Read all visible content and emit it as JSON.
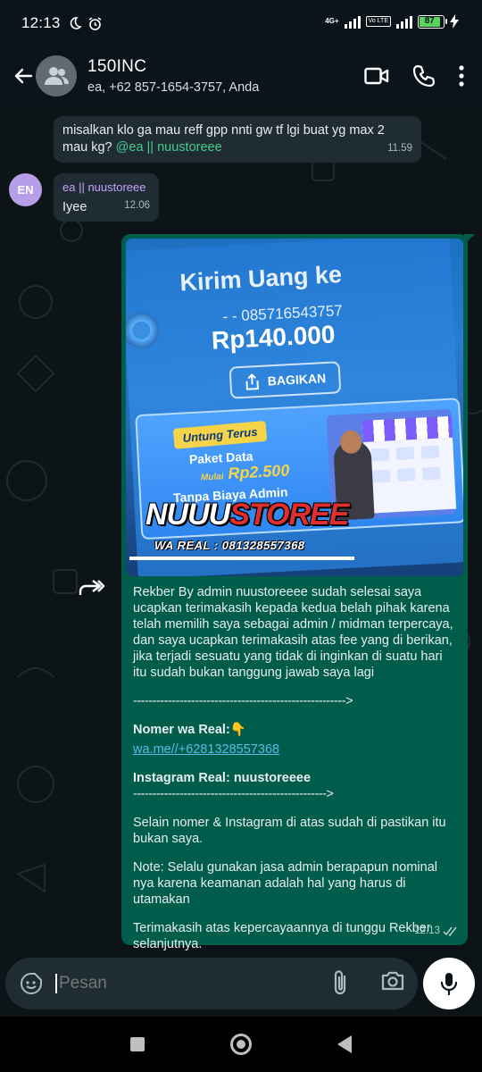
{
  "status_bar": {
    "time": "12:13",
    "network": "4G+",
    "volte": "Vo LTE",
    "battery": "87"
  },
  "header": {
    "title": "150INC",
    "subtitle": "ea, +62 857-1654-3757, Anda"
  },
  "messages": [
    {
      "type": "incoming",
      "text": "misalkan klo ga mau reff gpp nnti gw tf lgi buat yg max 2 mau kg? ",
      "mention": "@ea || nuustoreee",
      "time": "11.59"
    },
    {
      "type": "incoming",
      "avatar": "EN",
      "sender": "ea || nuustoreee",
      "text": "Iyee",
      "time": "12.06"
    },
    {
      "type": "outgoing",
      "forwarded": true,
      "image": {
        "kirim": "Kirim Uang ke",
        "rek": "- - 085716543757",
        "nominal": "Rp140.000",
        "bagikan": "BAGIKAN",
        "untung": "Untung Terus",
        "paket": "Paket Data",
        "mulai_prefix": "Mulai",
        "mulai_price": "Rp2.500",
        "tanpa": "Tanpa Biaya Admin",
        "brand_a": "NUUU",
        "brand_b": "STOREE",
        "wareal": "WA REAL : 081328557368"
      },
      "caption": {
        "para1": "Rekber By admin nuustoreeee sudah selesai saya ucapkan terimakasih kepada kedua belah pihak karena telah memilih saya sebagai admin / midman terpercaya, dan saya ucapkan terimakasih atas fee yang di berikan, jika terjadi sesuatu yang tidak di inginkan di suatu hari itu sudah bukan tanggung jawab saya lagi",
        "divider1": "------------------------------------------------------->",
        "nomer_label": "Nomer wa Real:👇",
        "link": "wa.me//+6281328557368",
        "ig_label": "Instagram Real: nuustoreeee",
        "divider2": "-------------------------------------------------->",
        "para2": "Selain nomer & Instagram di atas sudah di pastikan itu bukan saya.",
        "para3": "Note: Selalu gunakan jasa admin berapapun nominal nya karena keamanan adalah hal yang harus di utamakan",
        "para4": "Terimakasih atas kepercayaannya di tunggu Rekber selanjutnya."
      },
      "time": "12.13"
    }
  ],
  "input": {
    "placeholder": "Pesan"
  },
  "icons": {
    "back": "arrow-left-icon",
    "video": "video-call-icon",
    "call": "phone-icon",
    "menu": "more-vertical-icon",
    "sticker": "sticker-icon",
    "attach": "paperclip-icon",
    "camera": "camera-icon",
    "mic": "microphone-icon",
    "forward": "forward-icon"
  },
  "colors": {
    "outgoing_bubble": "#005c4b",
    "incoming_bubble": "#1f2c33",
    "mention": "#42cd8c",
    "link": "#53bdeb",
    "sender": "#c6a2ff"
  }
}
